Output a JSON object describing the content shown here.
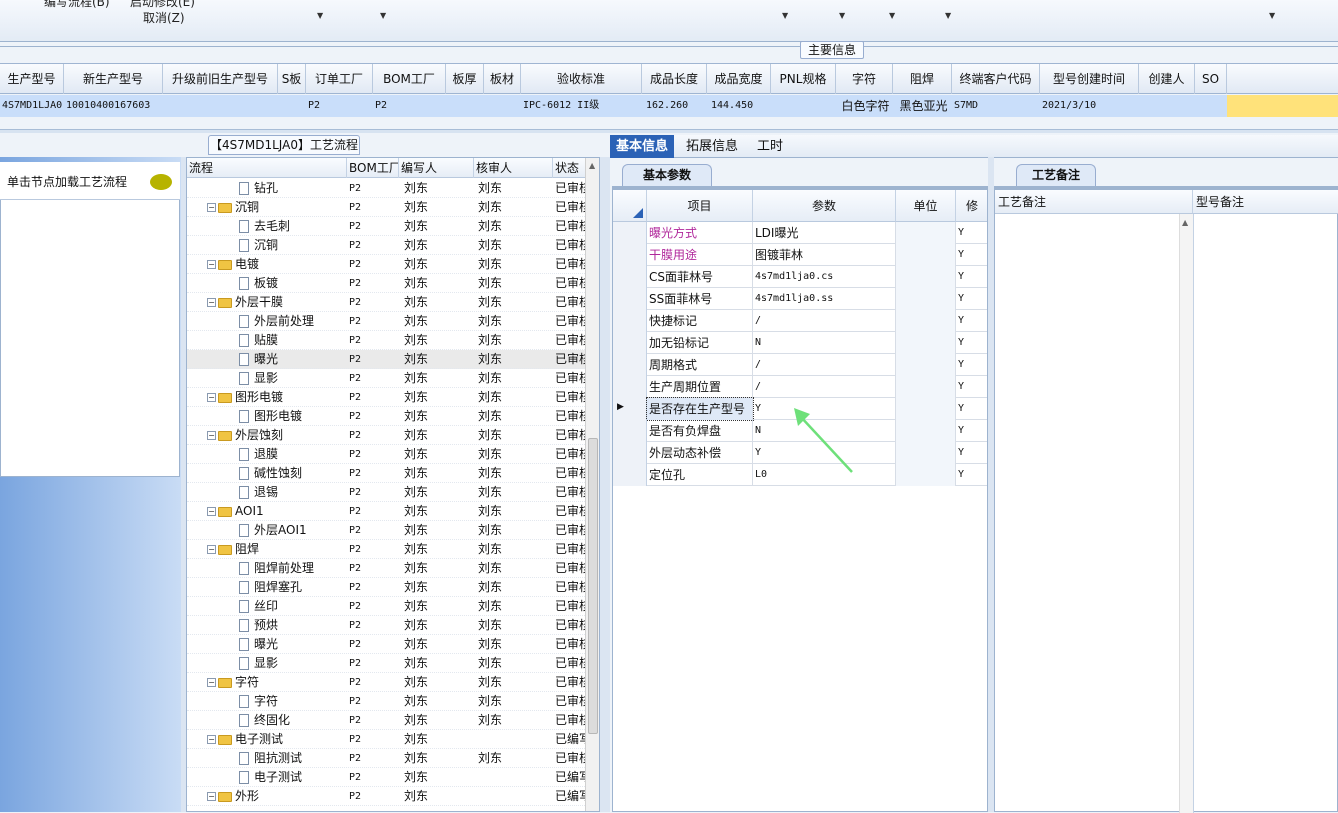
{
  "toolbar": {
    "item1": "编写流程(B)",
    "item2": "启动修改(E)",
    "item3": "取消(Z)"
  },
  "main_info_label": "主要信息",
  "top_table": {
    "headers": [
      "生产型号",
      "新生产型号",
      "升级前旧生产型号",
      "S板",
      "订单工厂",
      "BOM工厂",
      "板厚",
      "板材",
      "验收标准",
      "成品长度",
      "成品宽度",
      "PNL规格",
      "字符",
      "阻焊",
      "终端客户代码",
      "型号创建时间",
      "创建人",
      "SO"
    ],
    "row": [
      "4S7MD1LJA0",
      "10010400167603",
      "",
      "",
      "P2",
      "P2",
      "",
      "",
      "IPC-6012 II级",
      "162.260",
      "144.450",
      "",
      "白色字符",
      "黑色亚光",
      "S7MD",
      "2021/3/10",
      "",
      ""
    ]
  },
  "left_panel": {
    "hint": "单击节点加载工艺流程"
  },
  "process_tab": "【4S7MD1LJA0】工艺流程",
  "tree": {
    "headers": [
      "流程",
      "BOM工厂",
      "编写人",
      "核审人",
      "状态"
    ],
    "rows": [
      {
        "level": 2,
        "type": "doc",
        "name": "钻孔",
        "bom": "P2",
        "writer": "刘东",
        "checker": "刘东",
        "status": "已审核"
      },
      {
        "level": 1,
        "type": "folder",
        "name": "沉铜",
        "bom": "P2",
        "writer": "刘东",
        "checker": "刘东",
        "status": "已审核"
      },
      {
        "level": 2,
        "type": "doc",
        "name": "去毛刺",
        "bom": "P2",
        "writer": "刘东",
        "checker": "刘东",
        "status": "已审核"
      },
      {
        "level": 2,
        "type": "doc",
        "name": "沉铜",
        "bom": "P2",
        "writer": "刘东",
        "checker": "刘东",
        "status": "已审核"
      },
      {
        "level": 1,
        "type": "folder",
        "name": "电镀",
        "bom": "P2",
        "writer": "刘东",
        "checker": "刘东",
        "status": "已审核"
      },
      {
        "level": 2,
        "type": "doc",
        "name": "板镀",
        "bom": "P2",
        "writer": "刘东",
        "checker": "刘东",
        "status": "已审核"
      },
      {
        "level": 1,
        "type": "folder",
        "name": "外层干膜",
        "bom": "P2",
        "writer": "刘东",
        "checker": "刘东",
        "status": "已审核"
      },
      {
        "level": 2,
        "type": "doc",
        "name": "外层前处理",
        "bom": "P2",
        "writer": "刘东",
        "checker": "刘东",
        "status": "已审核"
      },
      {
        "level": 2,
        "type": "doc",
        "name": "贴膜",
        "bom": "P2",
        "writer": "刘东",
        "checker": "刘东",
        "status": "已审核"
      },
      {
        "level": 2,
        "type": "doc",
        "name": "曝光",
        "bom": "P2",
        "writer": "刘东",
        "checker": "刘东",
        "status": "已审核",
        "selected": true
      },
      {
        "level": 2,
        "type": "doc",
        "name": "显影",
        "bom": "P2",
        "writer": "刘东",
        "checker": "刘东",
        "status": "已审核"
      },
      {
        "level": 1,
        "type": "folder",
        "name": "图形电镀",
        "bom": "P2",
        "writer": "刘东",
        "checker": "刘东",
        "status": "已审核"
      },
      {
        "level": 2,
        "type": "doc",
        "name": "图形电镀",
        "bom": "P2",
        "writer": "刘东",
        "checker": "刘东",
        "status": "已审核"
      },
      {
        "level": 1,
        "type": "folder",
        "name": "外层蚀刻",
        "bom": "P2",
        "writer": "刘东",
        "checker": "刘东",
        "status": "已审核"
      },
      {
        "level": 2,
        "type": "doc",
        "name": "退膜",
        "bom": "P2",
        "writer": "刘东",
        "checker": "刘东",
        "status": "已审核"
      },
      {
        "level": 2,
        "type": "doc",
        "name": "碱性蚀刻",
        "bom": "P2",
        "writer": "刘东",
        "checker": "刘东",
        "status": "已审核"
      },
      {
        "level": 2,
        "type": "doc",
        "name": "退锡",
        "bom": "P2",
        "writer": "刘东",
        "checker": "刘东",
        "status": "已审核"
      },
      {
        "level": 1,
        "type": "folder",
        "name": "AOI1",
        "bom": "P2",
        "writer": "刘东",
        "checker": "刘东",
        "status": "已审核"
      },
      {
        "level": 2,
        "type": "doc",
        "name": "外层AOI1",
        "bom": "P2",
        "writer": "刘东",
        "checker": "刘东",
        "status": "已审核"
      },
      {
        "level": 1,
        "type": "folder",
        "name": "阻焊",
        "bom": "P2",
        "writer": "刘东",
        "checker": "刘东",
        "status": "已审核"
      },
      {
        "level": 2,
        "type": "doc",
        "name": "阻焊前处理",
        "bom": "P2",
        "writer": "刘东",
        "checker": "刘东",
        "status": "已审核"
      },
      {
        "level": 2,
        "type": "doc",
        "name": "阻焊塞孔",
        "bom": "P2",
        "writer": "刘东",
        "checker": "刘东",
        "status": "已审核"
      },
      {
        "level": 2,
        "type": "doc",
        "name": "丝印",
        "bom": "P2",
        "writer": "刘东",
        "checker": "刘东",
        "status": "已审核"
      },
      {
        "level": 2,
        "type": "doc",
        "name": "预烘",
        "bom": "P2",
        "writer": "刘东",
        "checker": "刘东",
        "status": "已审核"
      },
      {
        "level": 2,
        "type": "doc",
        "name": "曝光",
        "bom": "P2",
        "writer": "刘东",
        "checker": "刘东",
        "status": "已审核"
      },
      {
        "level": 2,
        "type": "doc",
        "name": "显影",
        "bom": "P2",
        "writer": "刘东",
        "checker": "刘东",
        "status": "已审核"
      },
      {
        "level": 1,
        "type": "folder",
        "name": "字符",
        "bom": "P2",
        "writer": "刘东",
        "checker": "刘东",
        "status": "已审核"
      },
      {
        "level": 2,
        "type": "doc",
        "name": "字符",
        "bom": "P2",
        "writer": "刘东",
        "checker": "刘东",
        "status": "已审核"
      },
      {
        "level": 2,
        "type": "doc",
        "name": "终固化",
        "bom": "P2",
        "writer": "刘东",
        "checker": "刘东",
        "status": "已审核"
      },
      {
        "level": 1,
        "type": "folder",
        "name": "电子测试",
        "bom": "P2",
        "writer": "刘东",
        "checker": "",
        "status": "已编写"
      },
      {
        "level": 2,
        "type": "doc",
        "name": "阻抗测试",
        "bom": "P2",
        "writer": "刘东",
        "checker": "刘东",
        "status": "已审核"
      },
      {
        "level": 2,
        "type": "doc",
        "name": "电子测试",
        "bom": "P2",
        "writer": "刘东",
        "checker": "",
        "status": "已编写"
      },
      {
        "level": 1,
        "type": "folder",
        "name": "外形",
        "bom": "P2",
        "writer": "刘东",
        "checker": "",
        "status": "已编写"
      }
    ]
  },
  "right_tabs": [
    "基本信息",
    "拓展信息",
    "工时"
  ],
  "sub_tab_params": "基本参数",
  "sub_tab_notes": "工艺备注",
  "params": {
    "headers": [
      "项目",
      "参数",
      "单位",
      "修"
    ],
    "rows": [
      {
        "item": "曝光方式",
        "param": "LDI曝光",
        "unit": "",
        "mod": "Y",
        "highlight": true
      },
      {
        "item": "干膜用途",
        "param": "图镀菲林",
        "unit": "",
        "mod": "Y",
        "highlight": true
      },
      {
        "item": "CS面菲林号",
        "param": "4s7md1lja0.cs",
        "unit": "",
        "mod": "Y"
      },
      {
        "item": "SS面菲林号",
        "param": "4s7md1lja0.ss",
        "unit": "",
        "mod": "Y"
      },
      {
        "item": "快捷标记",
        "param": "/",
        "unit": "",
        "mod": "Y"
      },
      {
        "item": "加无铅标记",
        "param": "N",
        "unit": "",
        "mod": "Y"
      },
      {
        "item": "周期格式",
        "param": "/",
        "unit": "",
        "mod": "Y"
      },
      {
        "item": "生产周期位置",
        "param": "/",
        "unit": "",
        "mod": "Y"
      },
      {
        "item": "是否存在生产型号",
        "param": "Y",
        "unit": "",
        "mod": "Y",
        "current": true
      },
      {
        "item": "是否有负焊盘",
        "param": "N",
        "unit": "",
        "mod": "Y"
      },
      {
        "item": "外层动态补偿",
        "param": "Y",
        "unit": "",
        "mod": "Y"
      },
      {
        "item": "定位孔",
        "param": "L0",
        "unit": "",
        "mod": "Y"
      }
    ]
  },
  "notes": {
    "headers": [
      "工艺备注",
      "型号备注"
    ]
  },
  "colors": {
    "accent": "#2b62b6",
    "highlight_text": "#b0279b",
    "selection_row": "#c9defa",
    "arrow": "#6ee07a"
  }
}
